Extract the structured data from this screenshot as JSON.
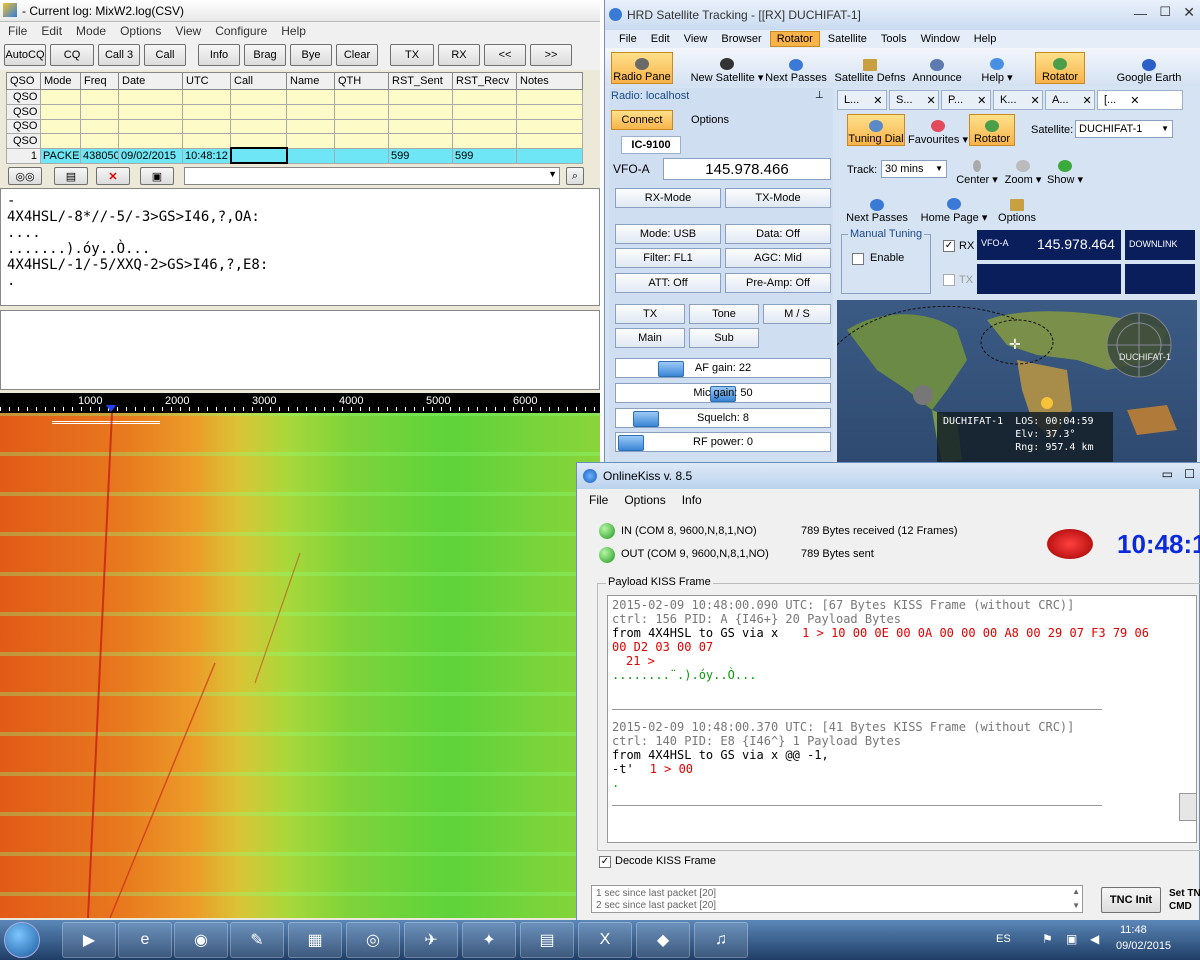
{
  "mixw": {
    "title": "- Current log: MixW2.log(CSV)",
    "menu": [
      "File",
      "Edit",
      "Mode",
      "Options",
      "View",
      "Configure",
      "Help"
    ],
    "toolbar": [
      "AutoCQ",
      "CQ",
      "Call 3",
      "Call",
      "Info",
      "Brag",
      "Bye",
      "Clear",
      "TX",
      "RX",
      "<<",
      ">>"
    ],
    "table": {
      "headers": [
        "QSO",
        "Mode",
        "Freq",
        "Date",
        "UTC",
        "Call",
        "Name",
        "QTH",
        "RST_Sent",
        "RST_Recv",
        "Notes"
      ],
      "empty_row_label": "QSO",
      "active_row": {
        "num": "1",
        "mode": "PACKE",
        "freq": "438050",
        "date": "09/02/2015",
        "utc": "10:48:12",
        "call": "",
        "name": "",
        "qth": "",
        "rst_sent": "599",
        "rst_recv": "599",
        "notes": ""
      }
    },
    "rx_text": "-\n4X4HSL/-8*//-5/-3>GS>I46,?,OA:\n....\n.......).óy..Ò...\n4X4HSL/-1/-5/XXQ-2>GS>I46,?,E8:\n.",
    "ruler_ticks": [
      "1000",
      "2000",
      "3000",
      "4000",
      "5000",
      "6000"
    ]
  },
  "hrd": {
    "title": "HRD Satellite Tracking - [[RX]  DUCHIFAT-1]",
    "menu": [
      "File",
      "Edit",
      "View",
      "Browser",
      "Rotator",
      "Satellite",
      "Tools",
      "Window",
      "Help"
    ],
    "menu_selected": "Rotator",
    "ribbon": [
      "Radio Pane",
      "New Satellite ▾",
      "Next Passes",
      "Satellite Defns",
      "Announce",
      "Help ▾",
      "Rotator",
      "Google Earth"
    ],
    "radio_label": "Radio: localhost",
    "connect": "Connect",
    "options": "Options",
    "rig": "IC-9100",
    "vfo_label": "VFO-A",
    "vfo_freq": "145.978.466",
    "rx_mode": "RX-Mode",
    "tx_mode": "TX-Mode",
    "mode": "Mode: USB",
    "data": "Data: Off",
    "filter": "Filter: FL1",
    "agc": "AGC: Mid",
    "att": "ATT: Off",
    "preamp": "Pre-Amp: Off",
    "tx": "TX",
    "tone": "Tone",
    "ms": "M / S",
    "main": "Main",
    "sub": "Sub",
    "af_gain": "AF gain: 22",
    "mic_gain": "Mic gain: 50",
    "squelch": "Squelch: 8",
    "rf_power": "RF power: 0",
    "af_gain_level": 22,
    "mic_gain_level": 50,
    "squelch_level": 8,
    "rf_power_level": 0,
    "tabs": [
      "L...",
      "S...",
      "P...",
      "K...",
      "A...",
      "[..."
    ],
    "tuning_dial": "Tuning Dial",
    "favourites": "Favourites ▾",
    "rotator": "Rotator",
    "satellite_label": "Satellite:",
    "satellite_value": "DUCHIFAT-1",
    "track_label": "Track:",
    "track_value": "30 mins",
    "center": "Center ▾",
    "zoom": "Zoom ▾",
    "show": "Show ▾",
    "next_passes": "Next Passes",
    "home_page": "Home Page ▾",
    "sat_options": "Options",
    "manual_tuning": "Manual Tuning",
    "enable": "Enable",
    "rx_label": "RX",
    "tx_label": "TX",
    "vfo_small": "VFO-A",
    "vfo_small_freq": "145.978.464",
    "downlink": "DOWNLINK",
    "map_sat_label": "DUCHIFAT-1",
    "status": "DUCHIFAT-1  LOS: 00:04:59\n            Elv: 37.3°\n            Rng: 957.4 km"
  },
  "kiss": {
    "title": "OnlineKiss v. 8.5",
    "menu": [
      "File",
      "Options",
      "Info"
    ],
    "in_port": "IN (COM 8, 9600,N,8,1,NO)",
    "in_stats": "789 Bytes received (12 Frames)",
    "out_port": "OUT (COM 9, 9600,N,8,1,NO)",
    "out_stats": "789 Bytes sent",
    "clock": "10:48:1",
    "payload_label": "Payload KISS Frame",
    "f1_header": "2015-02-09 10:48:00.090 UTC: [67 Bytes KISS Frame (without CRC)]",
    "f1_ctrl": "ctrl: 156   PID: A {I46+}   20 Payload Bytes",
    "f1_from": "from 4X4HSL to GS via  x",
    "f1_hex": "1 > 10 00 0E 00 0A 00 00 00 A8 00 29 07 F3 79 06",
    "f1_hex2": "00 D2 03 00 07",
    "f1_hex3": "21 >",
    "f1_ascii": "........¨.).óy..Ò...",
    "f2_header": "2015-02-09 10:48:00.370 UTC: [41 Bytes KISS Frame (without CRC)]",
    "f2_ctrl": "ctrl: 140   PID: E8 {I46^}   1 Payload Bytes",
    "f2_from": "from 4X4HSL to GS via  x @@ -1,",
    "f2_line2": "-t'",
    "f2_hex": "1 > 00",
    "f2_dot": ".",
    "decode": "Decode KISS Frame",
    "status1": "1 sec since last packet [20]",
    "status2": "2 sec since last packet [20]",
    "tnc_init": "TNC Init",
    "set_tnc": "Set TN",
    "cmd": "CMD M"
  },
  "taskbar": {
    "lang": "ES",
    "time": "11:48",
    "date": "09/02/2015"
  }
}
